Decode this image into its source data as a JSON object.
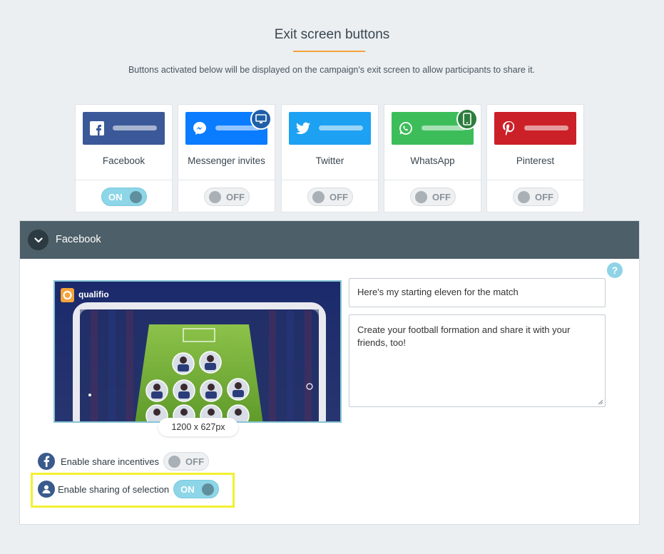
{
  "header": {
    "title": "Exit screen buttons",
    "subtitle": "Buttons activated below will be displayed on the campaign's exit screen to allow participants to share it."
  },
  "cards": [
    {
      "label": "Facebook",
      "color": "#3b5998",
      "icon": "facebook-icon",
      "state": "ON",
      "badge": null
    },
    {
      "label": "Messenger invites",
      "color": "#0a7cff",
      "icon": "messenger-icon",
      "state": "OFF",
      "badge": "desktop-icon",
      "badge_color": "#1f5fa7"
    },
    {
      "label": "Twitter",
      "color": "#1da1f2",
      "icon": "twitter-icon",
      "state": "OFF",
      "badge": null
    },
    {
      "label": "WhatsApp",
      "color": "#3dbd5a",
      "icon": "whatsapp-icon",
      "state": "OFF",
      "badge": "mobile-icon",
      "badge_color": "#2e7d3e"
    },
    {
      "label": "Pinterest",
      "color": "#cb2027",
      "icon": "pinterest-icon",
      "state": "OFF",
      "badge": null
    }
  ],
  "panel": {
    "title": "Facebook",
    "help": "?",
    "preview_brand": "qualifio",
    "image_size": "1200 x 627px",
    "share_title": "Here's my starting eleven for the match",
    "share_description": "Create your football formation and share it with your friends, too!",
    "options": [
      {
        "label": "Enable share incentives",
        "state": "OFF"
      },
      {
        "label": "Enable sharing of selection",
        "state": "ON"
      }
    ]
  }
}
